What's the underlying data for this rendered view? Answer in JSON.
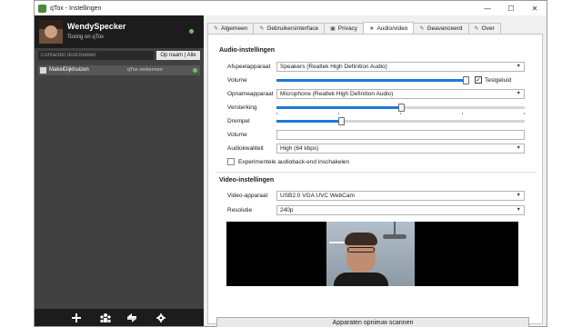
{
  "window": {
    "title": "qTox - Instellingen",
    "controls": {
      "minimize": "—",
      "maximize": "☐",
      "close": "✕"
    }
  },
  "profile": {
    "name": "WendySpecker",
    "status_message": "Toxing on qTox",
    "status": "online"
  },
  "search": {
    "placeholder": "Contacten doorzoeken",
    "sort_label": "Op naam | Alle"
  },
  "friends": [
    {
      "name": "MakelDijkhuizen",
      "status_message": "qTox verkennen",
      "status": "online"
    }
  ],
  "bottom_bar": {
    "icons": [
      "add-friend-icon",
      "group-icon",
      "transfer-icon",
      "settings-icon"
    ]
  },
  "tabs": [
    {
      "label": "Algemeen",
      "icon": "wrench-icon",
      "active": false
    },
    {
      "label": "Gebruikersinterface",
      "icon": "wrench-icon",
      "active": false
    },
    {
      "label": "Privacy",
      "icon": "lock-icon",
      "active": false
    },
    {
      "label": "Audio/video",
      "icon": "star-icon",
      "active": true
    },
    {
      "label": "Geavanceerd",
      "icon": "wrench-icon",
      "active": false
    },
    {
      "label": "Over",
      "icon": "wrench-icon",
      "active": false
    }
  ],
  "audio": {
    "section_title": "Audio-instellingen",
    "playback_label": "Afspeelapparaat",
    "playback_value": "Speakers (Realtek High Definition Audio)",
    "volume_label": "Volume",
    "playback_volume": 0.99,
    "test_sound_label": "Testgeluid",
    "test_sound_checked": true,
    "capture_label": "Opnameapparaat",
    "capture_value": "Microphone (Realtek High Definition Audio)",
    "gain_label": "Versterking",
    "gain_level": 0.5,
    "threshold_label": "Drempel",
    "threshold_level": 0.26,
    "capture_volume_label": "Volume",
    "quality_label": "Audiokwaliteit",
    "quality_value": "High (64 kbps)",
    "experimental_label": "Experimentele audioback-end inschakelen",
    "experimental_checked": false
  },
  "video": {
    "section_title": "Video-instellingen",
    "device_label": "Video-apparaat",
    "device_value": "USB2.0 VGA UVC WebCam",
    "resolution_label": "Resolutie",
    "resolution_value": "240p",
    "rescan_label": "Apparaten opnieuw scannen"
  },
  "colors": {
    "accent": "#1d78d6",
    "online": "#6bc260",
    "sidebar_bg": "#414141",
    "header_bg": "#1c1c1c"
  }
}
